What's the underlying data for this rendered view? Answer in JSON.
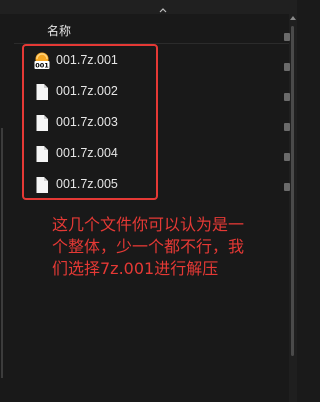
{
  "column_header": {
    "name_label": "名称"
  },
  "files": [
    {
      "name": "001.7z.001",
      "icon": "7zip-archive-icon"
    },
    {
      "name": "001.7z.002",
      "icon": "blank-file-icon"
    },
    {
      "name": "001.7z.003",
      "icon": "blank-file-icon"
    },
    {
      "name": "001.7z.004",
      "icon": "blank-file-icon"
    },
    {
      "name": "001.7z.005",
      "icon": "blank-file-icon"
    }
  ],
  "archive_icon_label": "001",
  "annotation": "这几个文件你可以认为是一个整体，少一个都不行，我们选择7z.001进行解压",
  "colors": {
    "highlight": "#e53935",
    "background": "#191919",
    "text": "#e6e6e6"
  }
}
